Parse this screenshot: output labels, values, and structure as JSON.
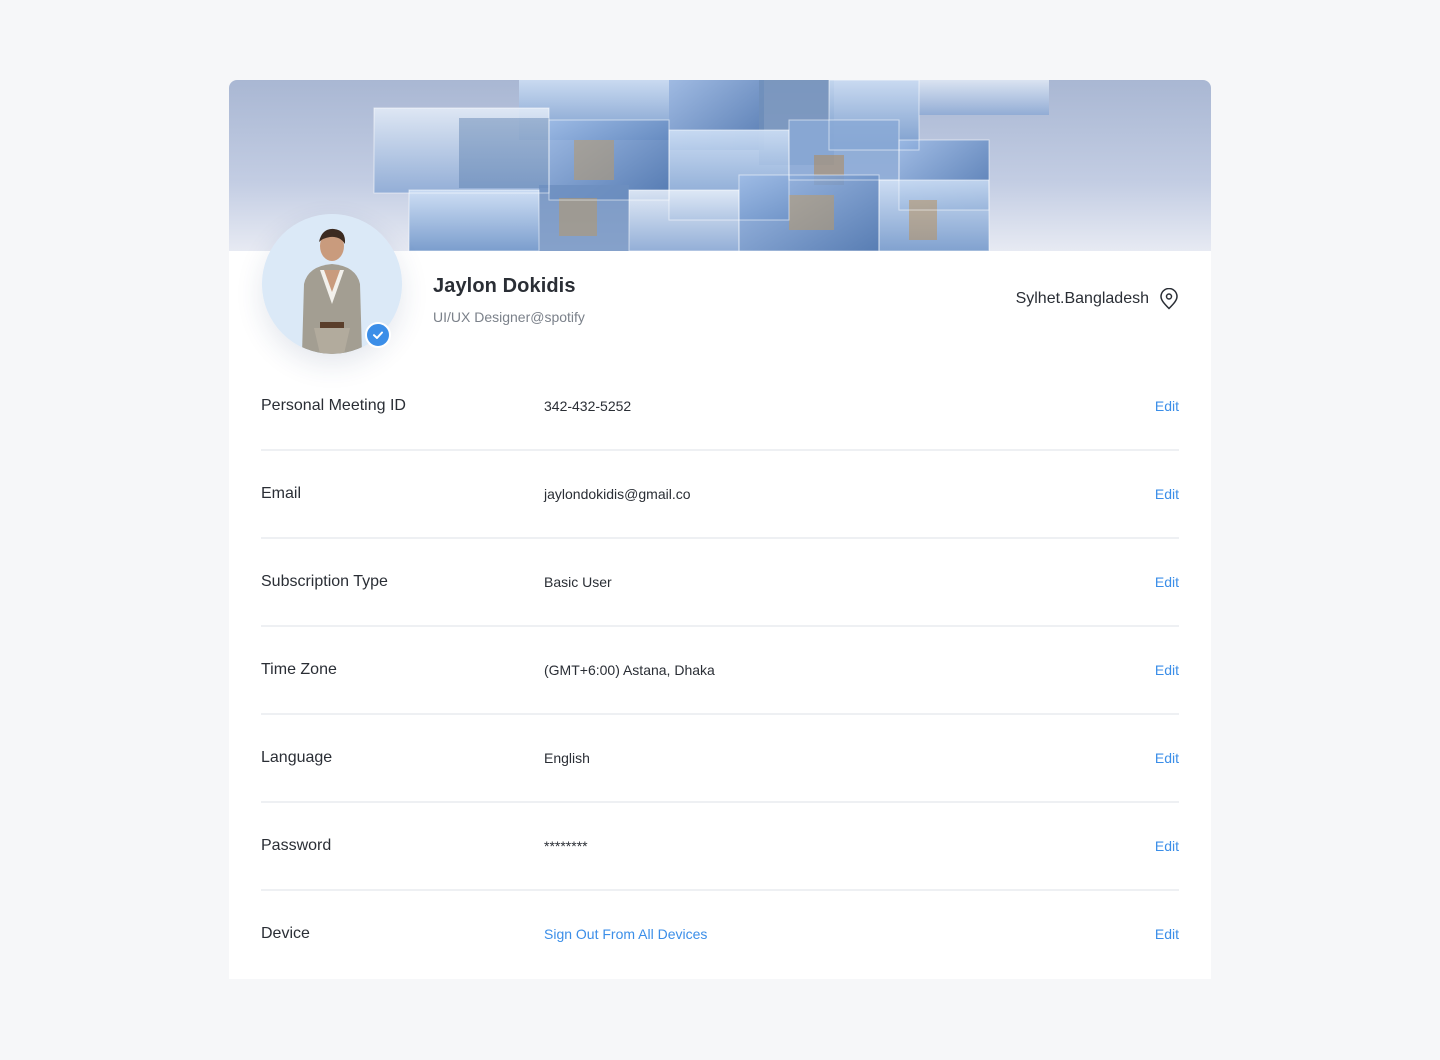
{
  "profile": {
    "name": "Jaylon Dokidis",
    "subtitle": "UI/UX Designer@spotify",
    "location": "Sylhet.Bangladesh",
    "verified": true
  },
  "colors": {
    "accent": "#3b8ee8",
    "background": "#f6f7f9",
    "card": "#ffffff",
    "divider": "#eef0f3"
  },
  "icons": {
    "location": "map-pin-icon",
    "verified": "check-badge-icon"
  },
  "rows": [
    {
      "label": "Personal Meeting ID",
      "value": "342-432-5252",
      "action": "Edit"
    },
    {
      "label": "Email",
      "value": "jaylondokidis@gmail.co",
      "action": "Edit"
    },
    {
      "label": "Subscription Type",
      "value": "Basic User",
      "action": "Edit"
    },
    {
      "label": "Time Zone",
      "value": "(GMT+6:00) Astana, Dhaka",
      "action": "Edit"
    },
    {
      "label": "Language",
      "value": "English",
      "action": "Edit"
    },
    {
      "label": "Password",
      "value": "********",
      "action": "Edit"
    },
    {
      "label": "Device",
      "value": "Sign Out From All Devices",
      "action": "Edit"
    }
  ]
}
